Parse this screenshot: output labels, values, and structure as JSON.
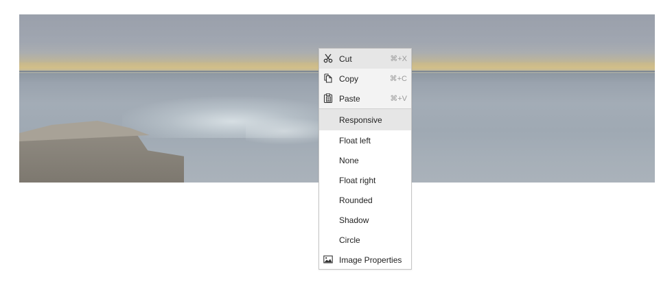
{
  "menu": {
    "clipboard": [
      {
        "label": "Cut",
        "shortcut": "⌘+X",
        "icon": "scissors-icon"
      },
      {
        "label": "Copy",
        "shortcut": "⌘+C",
        "icon": "copy-icon"
      },
      {
        "label": "Paste",
        "shortcut": "⌘+V",
        "icon": "paste-icon"
      }
    ],
    "styles": [
      {
        "label": "Responsive"
      },
      {
        "label": "Float left"
      },
      {
        "label": "None"
      },
      {
        "label": "Float right"
      },
      {
        "label": "Rounded"
      },
      {
        "label": "Shadow"
      },
      {
        "label": "Circle"
      }
    ],
    "properties": {
      "label": "Image Properties",
      "icon": "image-icon"
    }
  },
  "colors": {
    "menu_border": "#c4c4c4",
    "hover": "#e6e6e6",
    "shortcut_text": "#9a9a9a"
  }
}
